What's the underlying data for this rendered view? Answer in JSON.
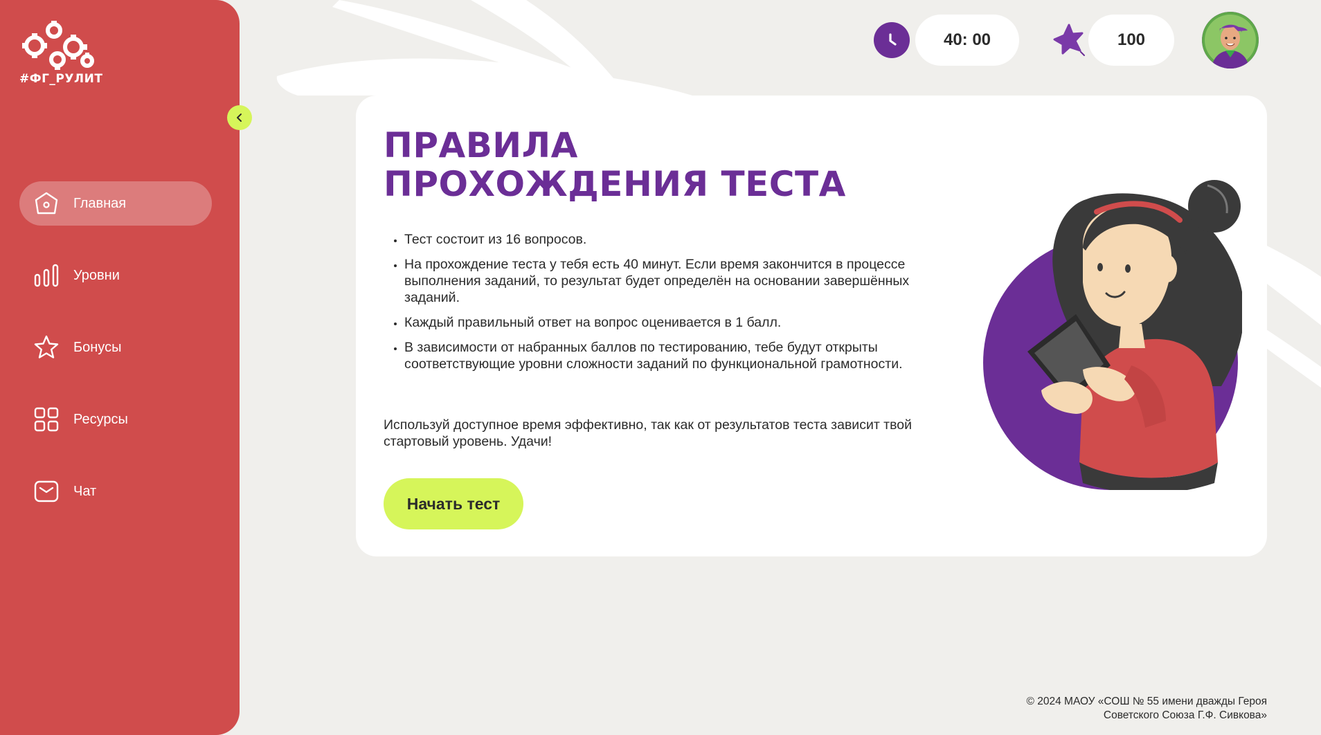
{
  "brand": {
    "logo_text": "#ФГ_РУЛИТ"
  },
  "sidebar": {
    "items": [
      {
        "label": "Главная",
        "icon": "home-icon",
        "active": true
      },
      {
        "label": "Уровни",
        "icon": "levels-icon",
        "active": false
      },
      {
        "label": "Бонусы",
        "icon": "star-icon",
        "active": false
      },
      {
        "label": "Ресурсы",
        "icon": "grid-icon",
        "active": false
      },
      {
        "label": "Чат",
        "icon": "chat-icon",
        "active": false
      }
    ]
  },
  "topbar": {
    "timer": "40: 00",
    "score": "100"
  },
  "card": {
    "title_line1": "ПРАВИЛА",
    "title_line2": "ПРОХОЖДЕНИЯ ТЕСТА",
    "rules": [
      "Тест состоит из 16 вопросов.",
      "На прохождение теста у тебя есть 40 минут. Если время закончится в процессе выполнения заданий, то результат будет определён на основании завершённых заданий.",
      "Каждый правильный ответ на вопрос оценивается в 1 балл.",
      "В зависимости от набранных баллов по тестированию, тебе будут открыты соответствующие уровни сложности заданий по функциональной грамотности."
    ],
    "outro": "Используй доступное время эффективно, так как от результатов теста зависит твой стартовый уровень. Удачи!",
    "start_button": "Начать тест"
  },
  "footer": {
    "line1": "© 2024 МАОУ «СОШ № 55 имени дважды Героя",
    "line2": "Советского Союза Г.Ф. Сивкова»"
  },
  "colors": {
    "sidebar": "#d04c4c",
    "accent_purple": "#6b2e96",
    "accent_lime": "#d6f55a",
    "background": "#f0efec"
  }
}
